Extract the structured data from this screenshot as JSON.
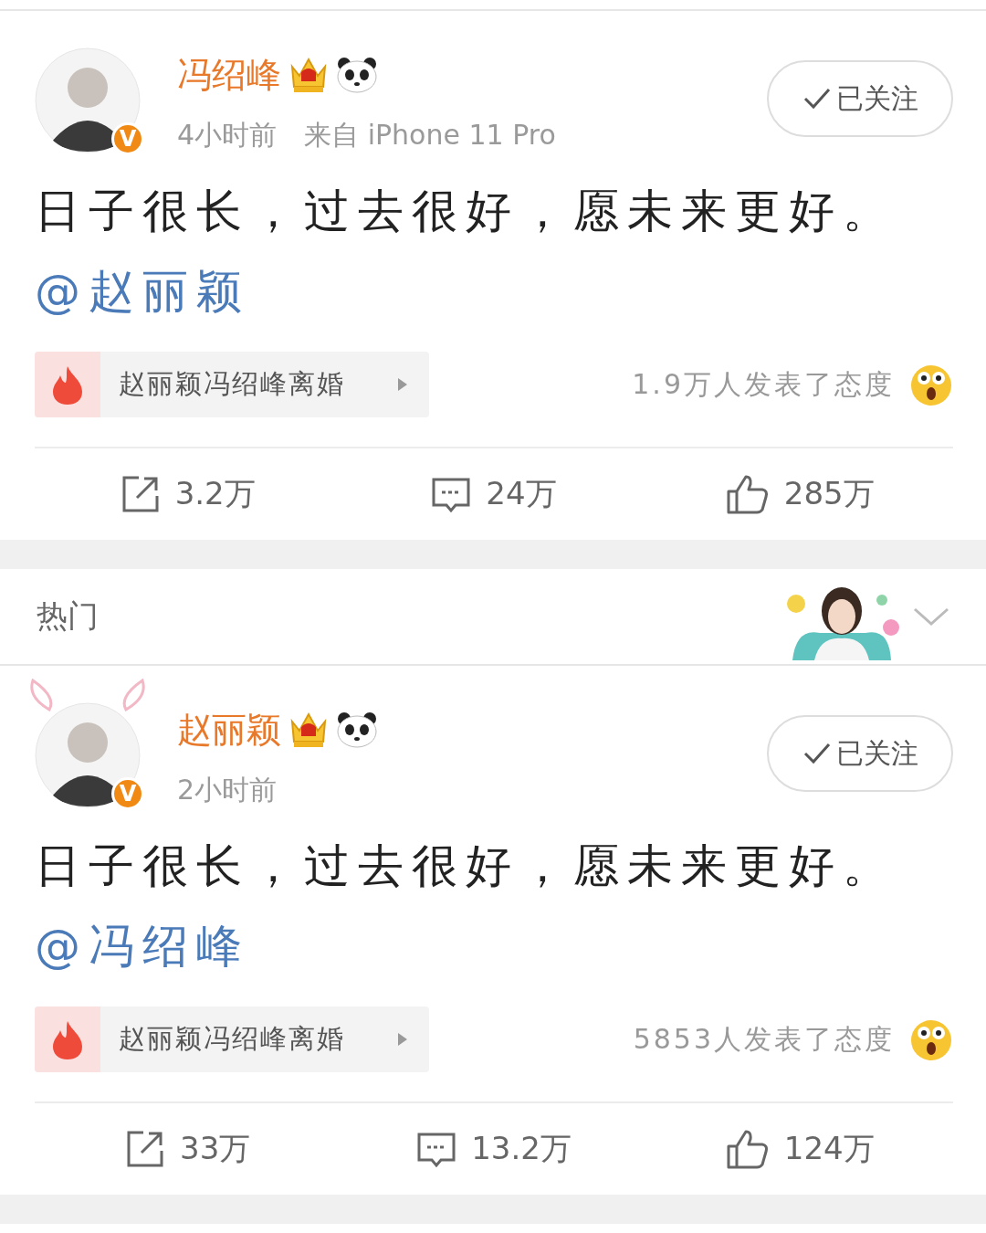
{
  "posts": [
    {
      "author": "冯绍峰",
      "verified_badge": "V",
      "bunny_ears": false,
      "time": "4小时前",
      "source": "来自 iPhone 11 Pro",
      "following": true,
      "follow_label": "已关注",
      "text": "日子很长，过去很好，愿未来更好。",
      "mention": "@赵丽颖",
      "topic": "赵丽颖冯绍峰离婚",
      "reactions": "1.9万人发表了态度",
      "reposts": "3.2万",
      "comments": "24万",
      "likes": "285万"
    },
    {
      "author": "赵丽颖",
      "verified_badge": "V",
      "bunny_ears": true,
      "time": "2小时前",
      "following": true,
      "follow_label": "已关注",
      "text": "日子很长，过去很好，愿未来更好。",
      "mention": "@冯绍峰",
      "topic": "赵丽颖冯绍峰离婚",
      "reactions": "5853人发表了态度",
      "reposts": "33万",
      "comments": "13.2万",
      "likes": "124万"
    }
  ],
  "hot_section": {
    "label": "热门",
    "expanded": false
  }
}
